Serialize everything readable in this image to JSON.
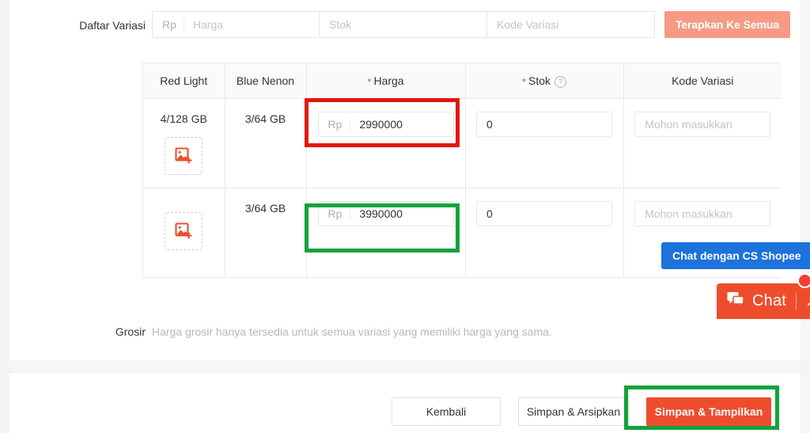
{
  "form": {
    "variation_list_label": "Daftar Variasi",
    "bulk": {
      "price_prefix": "Rp",
      "price_placeholder": "Harga",
      "stock_placeholder": "Stok",
      "code_placeholder": "Kode Variasi"
    },
    "apply_all_label": "Terapkan Ke Semua"
  },
  "table": {
    "headers": {
      "col1": "Red Light",
      "col2": "Blue Nenon",
      "col3": "Harga",
      "col4": "Stok",
      "col5": "Kode Variasi"
    },
    "required_marker": "*",
    "help_icon_glyph": "?",
    "rows": [
      {
        "option1": "4/128 GB",
        "option2": "3/64 GB",
        "price_prefix": "Rp",
        "price_value": "2990000",
        "stock_value": "0",
        "code_placeholder": "Mohon masukkan",
        "image_upload_icon": "image-add-icon"
      },
      {
        "option1": "",
        "option2": "3/64 GB",
        "price_prefix": "Rp",
        "price_value": "3990000",
        "stock_value": "0",
        "code_placeholder": "Mohon masukkan",
        "image_upload_icon": "image-add-icon"
      }
    ]
  },
  "grosir": {
    "label": "Grosir",
    "note": "Harga grosir hanya tersedia untuk semua variasi yang memiliki harga yang sama."
  },
  "footer": {
    "back_label": "Kembali",
    "save_archive_label": "Simpan & Arsipkan",
    "save_publish_label": "Simpan & Tampilkan"
  },
  "chat": {
    "cs_pill_label": "Chat dengan CS Shopee",
    "widget_label": "Chat"
  },
  "colors": {
    "accent": "#ee4d2d",
    "apply_all_bg": "#f79a84",
    "cs_pill_bg": "#1d72db",
    "annotation_red": "#e3170f",
    "annotation_green": "#12a33c"
  }
}
